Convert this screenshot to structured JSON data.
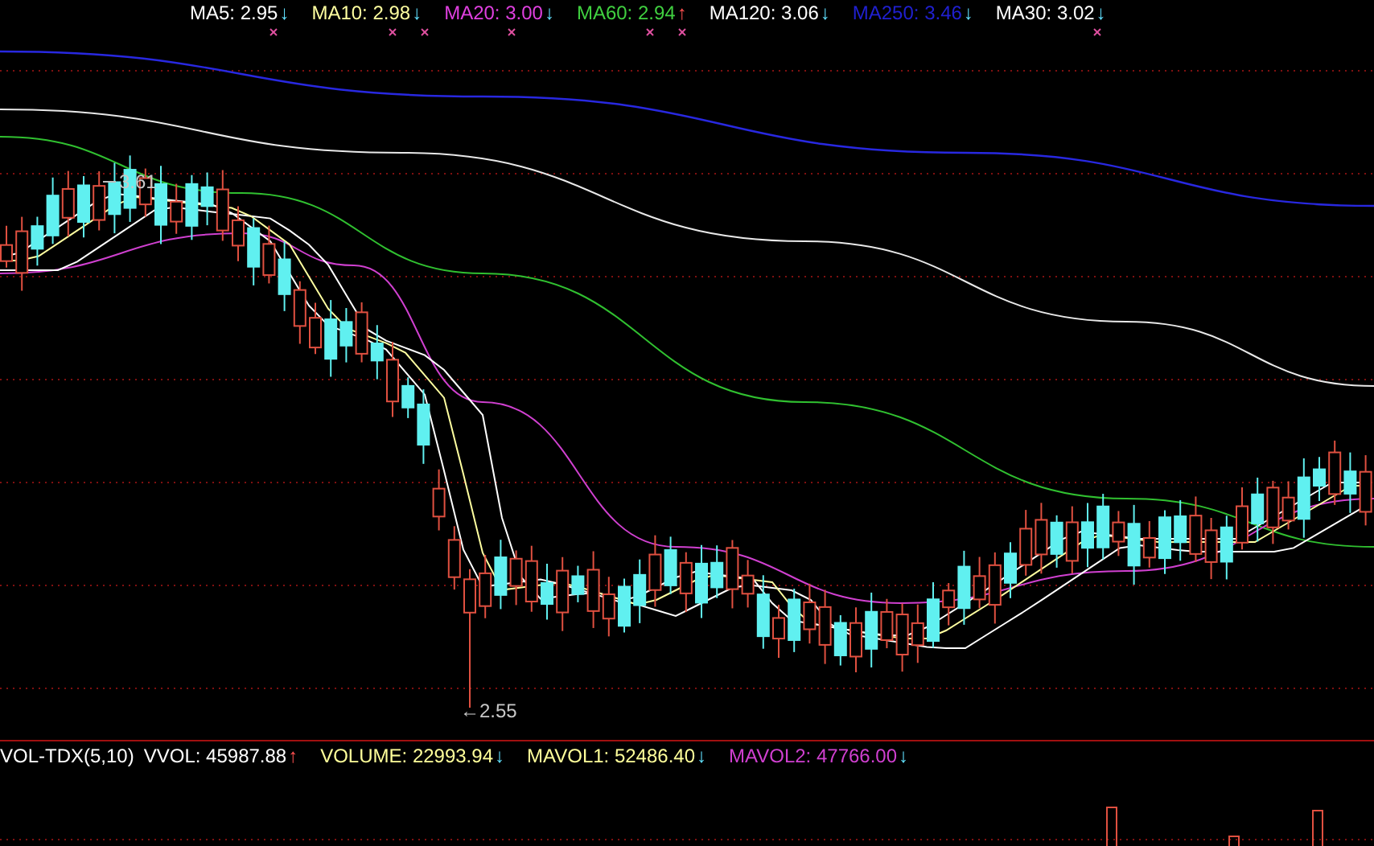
{
  "price_panel": {
    "legend": [
      {
        "label": "MA5: 2.95",
        "color": "#ffffff",
        "arrow": "↓",
        "kind": "down"
      },
      {
        "label": "MA10: 2.98",
        "color": "#ffffa0",
        "arrow": "↓",
        "kind": "down"
      },
      {
        "label": "MA20: 3.00",
        "color": "#e040e0",
        "arrow": "↓",
        "kind": "down"
      },
      {
        "label": "MA60: 2.94",
        "color": "#40d040",
        "arrow": "↑",
        "kind": "up"
      },
      {
        "label": "MA120: 3.06",
        "color": "#ffffff",
        "arrow": "↓",
        "kind": "down"
      },
      {
        "label": "MA250: 3.46",
        "color": "#2020d0",
        "arrow": "↓",
        "kind": "down"
      },
      {
        "label": "MA30: 3.02",
        "color": "#ffffff",
        "arrow": "↓",
        "kind": "down"
      }
    ],
    "annotations": [
      {
        "text": "3.61",
        "kind": "high"
      },
      {
        "text": "←2.55",
        "kind": "low"
      }
    ]
  },
  "volume_panel": {
    "indicator": "VOL-TDX(5,10)",
    "legend": [
      {
        "label": "VVOL: 45987.88",
        "color": "#ffffff",
        "arrow": "↑",
        "kind": "up"
      },
      {
        "label": "VOLUME: 22993.94",
        "color": "#ffff9a",
        "arrow": "↓",
        "kind": "down"
      },
      {
        "label": "MAVOL1: 52486.40",
        "color": "#ffff9a",
        "arrow": "↓",
        "kind": "down"
      },
      {
        "label": "MAVOL2: 47766.00",
        "color": "#d040d0",
        "arrow": "↓",
        "kind": "down"
      }
    ]
  }
}
